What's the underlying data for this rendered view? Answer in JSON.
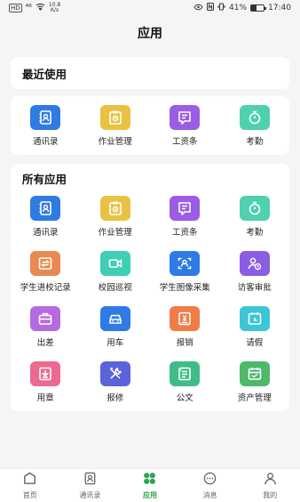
{
  "status_bar": {
    "net_chip": "HD",
    "signal": "⁴⁶",
    "speed_value": "10.8",
    "speed_unit": "K/s",
    "battery": "41%",
    "time": "17:40",
    "battery_level": 0.41
  },
  "header": {
    "title": "应用"
  },
  "recent": {
    "title": "最近使用",
    "apps": [
      {
        "label": "通讯录",
        "icon": "contact-book-icon",
        "color": "#2f7ae5"
      },
      {
        "label": "作业管理",
        "icon": "assignment-icon",
        "color": "#e9c244"
      },
      {
        "label": "工资条",
        "icon": "salary-slip-icon",
        "color": "#9b5de5"
      },
      {
        "label": "考勤",
        "icon": "stopwatch-icon",
        "color": "#4fd1b0"
      }
    ]
  },
  "all_apps": {
    "title": "所有应用",
    "apps": [
      {
        "label": "通讯录",
        "icon": "contact-book-icon",
        "color": "#2f7ae5"
      },
      {
        "label": "作业管理",
        "icon": "assignment-icon",
        "color": "#e9c244"
      },
      {
        "label": "工资条",
        "icon": "salary-slip-icon",
        "color": "#9b5de5"
      },
      {
        "label": "考勤",
        "icon": "stopwatch-icon",
        "color": "#4fd1b0"
      },
      {
        "label": "学生进校记录",
        "icon": "entry-exit-icon",
        "color": "#e88a4f"
      },
      {
        "label": "校园巡视",
        "icon": "video-camera-icon",
        "color": "#3ecfb5"
      },
      {
        "label": "学生图像采集",
        "icon": "face-scan-icon",
        "color": "#2f7ae5"
      },
      {
        "label": "访客审批",
        "icon": "visitor-icon",
        "color": "#8b5de5"
      },
      {
        "label": "出差",
        "icon": "briefcase-icon",
        "color": "#b46be0"
      },
      {
        "label": "用车",
        "icon": "car-icon",
        "color": "#2f7ae5"
      },
      {
        "label": "报销",
        "icon": "reimburse-icon",
        "color": "#ef7d45"
      },
      {
        "label": "请假",
        "icon": "leave-calendar-icon",
        "color": "#3cc6d6"
      },
      {
        "label": "用章",
        "icon": "stamp-icon",
        "color": "#ec6a8f"
      },
      {
        "label": "报修",
        "icon": "tools-icon",
        "color": "#5a63d9"
      },
      {
        "label": "公文",
        "icon": "document-icon",
        "color": "#3ebd86"
      },
      {
        "label": "资产管理",
        "icon": "asset-calendar-icon",
        "color": "#4db96a"
      }
    ]
  },
  "tab_bar": {
    "active_color": "#2ea44f",
    "tabs": [
      {
        "label": "首页",
        "icon": "home-icon",
        "active": false
      },
      {
        "label": "通讯录",
        "icon": "contacts-tab-icon",
        "active": false
      },
      {
        "label": "应用",
        "icon": "apps-grid-icon",
        "active": true
      },
      {
        "label": "消息",
        "icon": "message-icon",
        "active": false
      },
      {
        "label": "我的",
        "icon": "profile-icon",
        "active": false
      }
    ]
  }
}
